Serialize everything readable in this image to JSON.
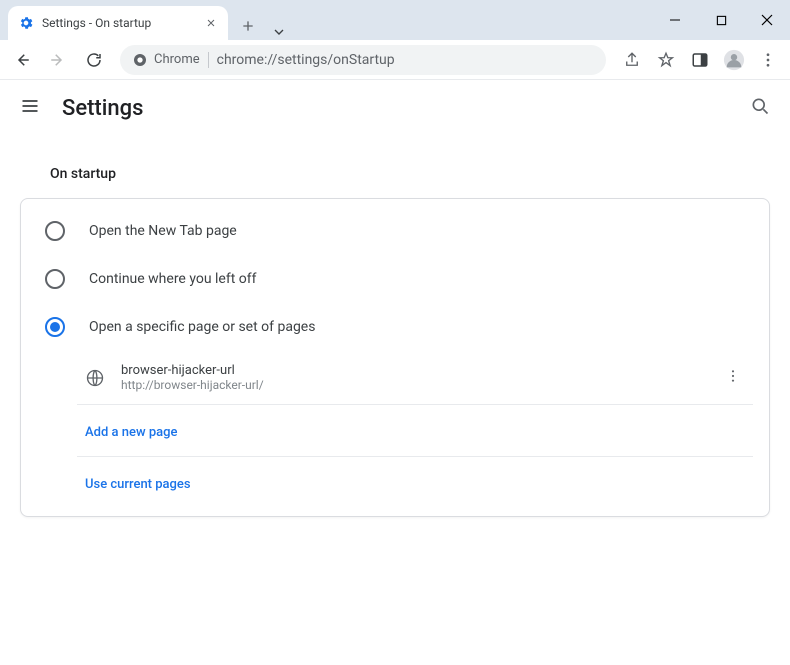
{
  "window": {
    "tab_title": "Settings - On startup"
  },
  "omnibox": {
    "secure_label": "Chrome",
    "url": "chrome://settings/onStartup"
  },
  "settings_header": {
    "title": "Settings"
  },
  "section": {
    "label": "On startup"
  },
  "radios": {
    "new_tab": "Open the New Tab page",
    "continue": "Continue where you left off",
    "specific": "Open a specific page or set of pages"
  },
  "pages": [
    {
      "name": "browser-hijacker-url",
      "url": "http://browser-hijacker-url/"
    }
  ],
  "links": {
    "add_page": "Add a new page",
    "use_current": "Use current pages"
  }
}
